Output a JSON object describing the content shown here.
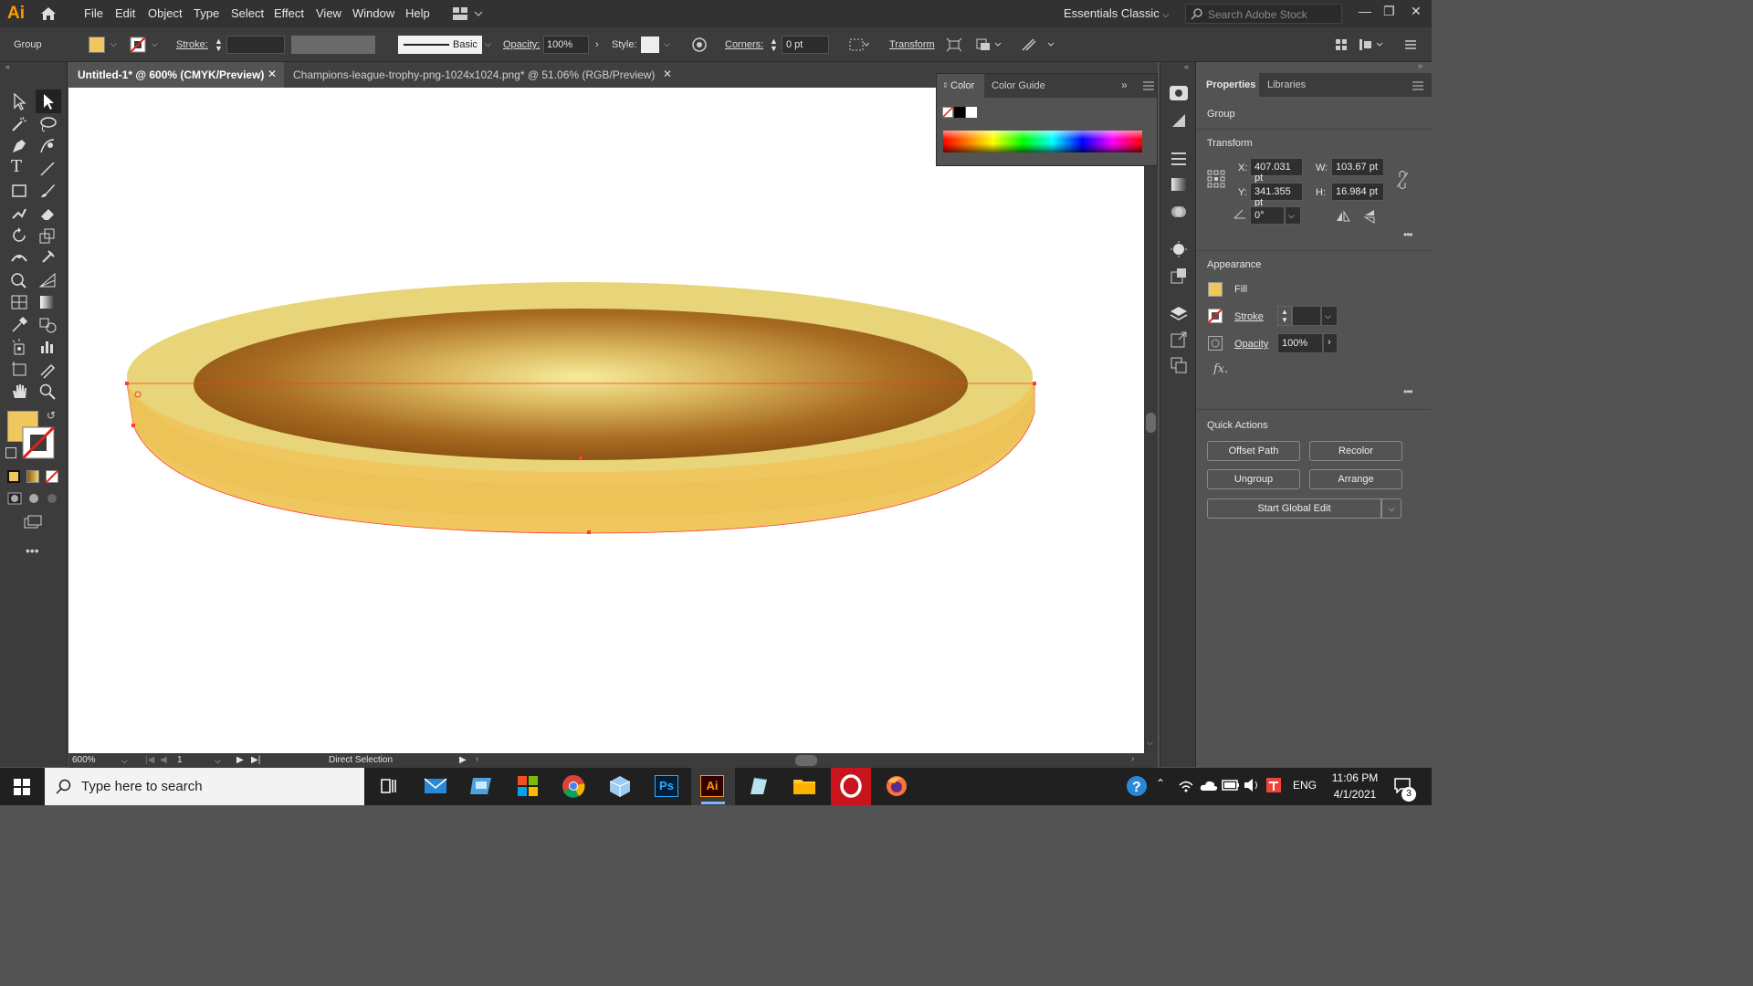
{
  "app": {
    "logo": "Ai"
  },
  "menubar": {
    "items": [
      "File",
      "Edit",
      "Object",
      "Type",
      "Select",
      "Effect",
      "View",
      "Window",
      "Help"
    ],
    "workspace": "Essentials Classic",
    "search_placeholder": "Search Adobe Stock"
  },
  "control_bar": {
    "selection": "Group",
    "stroke_label": "Stroke:",
    "brush": "Basic",
    "opacity_label": "Opacity:",
    "opacity_value": "100%",
    "style_label": "Style:",
    "corners_label": "Corners:",
    "corners_value": "0 pt",
    "transform_label": "Transform"
  },
  "tabs": [
    {
      "label": "Untitled-1* @ 600% (CMYK/Preview)",
      "active": true
    },
    {
      "label": "Champions-league-trophy-png-1024x1024.png* @ 51.06% (RGB/Preview)",
      "active": false
    }
  ],
  "status": {
    "zoom": "600%",
    "artboard": "1",
    "tool": "Direct Selection"
  },
  "color_panel": {
    "tab_color": "Color",
    "tab_guide": "Color Guide"
  },
  "properties": {
    "tab_properties": "Properties",
    "tab_libraries": "Libraries",
    "selection": "Group",
    "transform_heading": "Transform",
    "x_label": "X:",
    "x_value": "407.031 pt",
    "y_label": "Y:",
    "y_value": "341.355 pt",
    "w_label": "W:",
    "w_value": "103.67 pt",
    "h_label": "H:",
    "h_value": "16.984 pt",
    "angle_value": "0°",
    "appearance_heading": "Appearance",
    "fill_label": "Fill",
    "stroke_label": "Stroke",
    "opacity_label": "Opacity",
    "opacity_value": "100%",
    "fx_label": "fx.",
    "quick_actions_heading": "Quick Actions",
    "btn_offset_path": "Offset Path",
    "btn_recolor": "Recolor",
    "btn_ungroup": "Ungroup",
    "btn_arrange": "Arrange",
    "btn_global_edit": "Start Global Edit"
  },
  "taskbar": {
    "search_placeholder": "Type here to search",
    "language": "ENG",
    "time": "11:06 PM",
    "date": "4/1/2021",
    "notification_count": "3"
  },
  "colors": {
    "fill": "#f0c75e",
    "rim": "#e8d57a",
    "gradient_center": "#f6ec9a",
    "gradient_edge": "#8f5414",
    "selection": "#ff3b2f"
  }
}
